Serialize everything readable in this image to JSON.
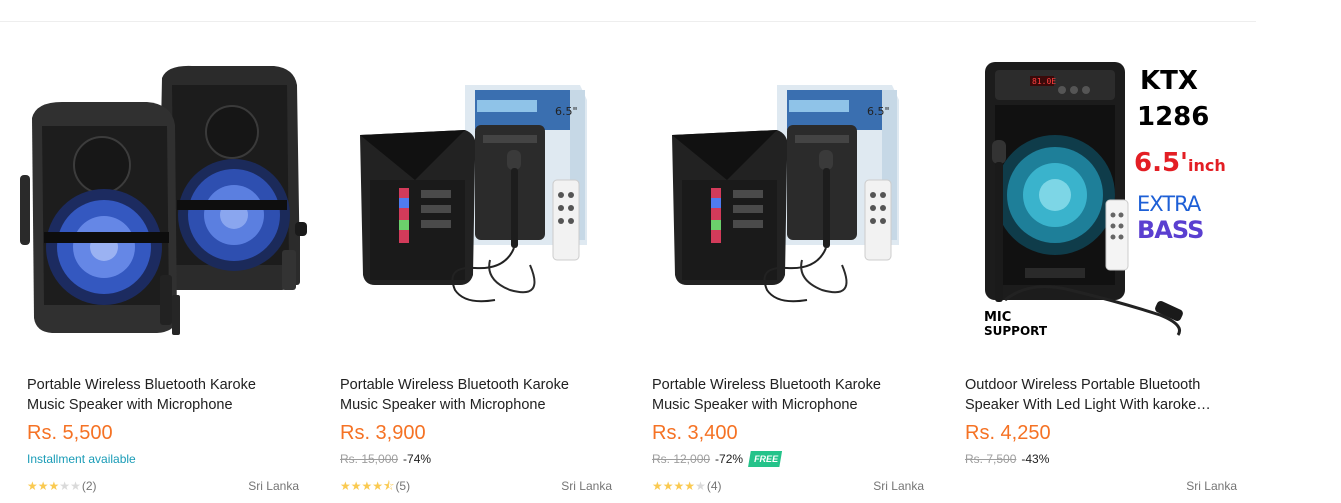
{
  "products": [
    {
      "title": "Portable Wireless Bluetooth Karoke Music Speaker with Microphone",
      "price": "Rs. 5,500",
      "installment": "Installment available",
      "rating": 3,
      "review_count": "(2)",
      "location": "Sri Lanka"
    },
    {
      "title": "Portable Wireless Bluetooth Karoke Music Speaker with Microphone",
      "price": "Rs. 3,900",
      "original_price": "Rs. 15,000",
      "discount": "-74%",
      "rating": 4.5,
      "review_count": "(5)",
      "location": "Sri Lanka"
    },
    {
      "title": "Portable Wireless Bluetooth Karoke Music Speaker with Microphone",
      "price": "Rs. 3,400",
      "original_price": "Rs. 12,000",
      "discount": "-72%",
      "badge": "FREE",
      "rating": 4,
      "review_count": "(4)",
      "location": "Sri Lanka"
    },
    {
      "title": "Outdoor Wireless Portable Bluetooth Speaker With Led Light With karoke…",
      "price": "Rs. 4,250",
      "original_price": "Rs. 7,500",
      "discount": "-43%",
      "location": "Sri Lanka",
      "image_text": {
        "model_line1": "KTX",
        "model_line2": "1286",
        "size": "6.5'",
        "size_unit": "inch",
        "extra": "EXTRA",
        "bass": "BASS",
        "mic": "MIC",
        "support": "SUPPORT"
      }
    }
  ],
  "colors": {
    "price": "#f57224",
    "installment": "#1a9cb7",
    "star": "#faca51",
    "star_empty": "#dadada",
    "free_badge": "#25c38a"
  }
}
